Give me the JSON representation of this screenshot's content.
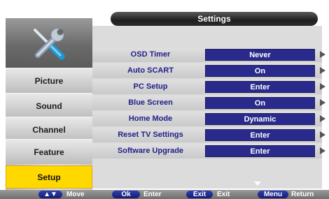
{
  "header": {
    "title": "Settings"
  },
  "sidebar": {
    "icon": "tools-icon",
    "items": [
      {
        "label": "Picture",
        "active": false
      },
      {
        "label": "Sound",
        "active": false
      },
      {
        "label": "Channel",
        "active": false
      },
      {
        "label": "Feature",
        "active": false
      },
      {
        "label": "Setup",
        "active": true
      }
    ]
  },
  "settings": [
    {
      "label": "OSD Timer",
      "value": "Never"
    },
    {
      "label": "Auto SCART",
      "value": "On"
    },
    {
      "label": "PC Setup",
      "value": "Enter"
    },
    {
      "label": "Blue Screen",
      "value": "On"
    },
    {
      "label": "Home Mode",
      "value": "Dynamic"
    },
    {
      "label": "Reset TV Settings",
      "value": "Enter"
    },
    {
      "label": "Software Upgrade",
      "value": "Enter"
    }
  ],
  "footer": {
    "move_key": "▲▼",
    "move_label": "Move",
    "ok_key": "Ok",
    "ok_label": "Enter",
    "exit_key": "Exit",
    "exit_label": "Exit",
    "menu_key": "Menu",
    "menu_label": "Return"
  },
  "colors": {
    "accent": "#ffd800",
    "value_bg": "#2a2a8c",
    "label_text": "#1f1f8a"
  }
}
